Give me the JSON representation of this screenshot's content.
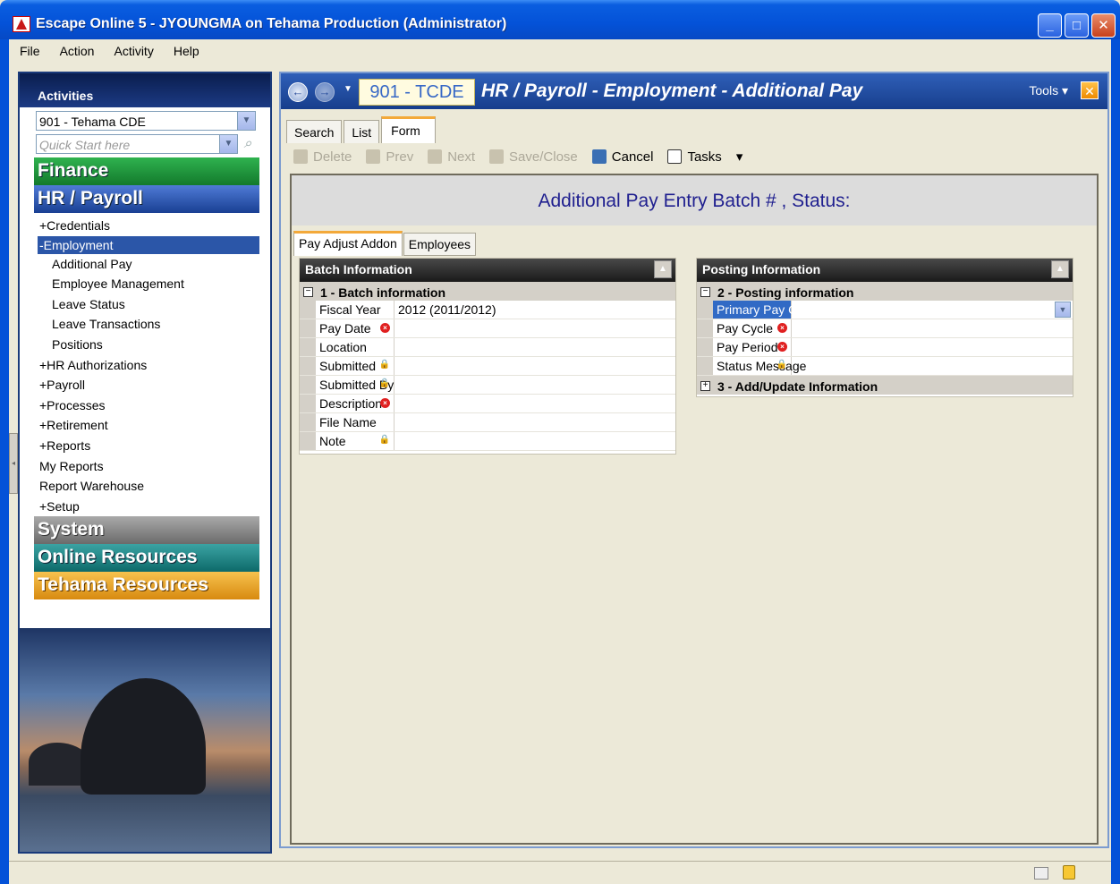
{
  "window": {
    "title": "Escape Online 5 - JYOUNGMA on Tehama Production (Administrator)",
    "minimize": "_",
    "maximize": "□",
    "close": "✕"
  },
  "menu": [
    "File",
    "Action",
    "Activity",
    "Help"
  ],
  "sidebar": {
    "header": "Activities",
    "district_combo": "901 - Tehama CDE",
    "quick_start_placeholder": "Quick Start here",
    "sections": {
      "finance": "Finance",
      "hr": "HR / Payroll",
      "system": "System",
      "online": "Online Resources",
      "tehama": "Tehama Resources"
    },
    "tree": [
      {
        "label": "+Credentials",
        "level": 0
      },
      {
        "label": "-Employment",
        "level": 0,
        "selected": true
      },
      {
        "label": "Additional Pay",
        "level": 1
      },
      {
        "label": "Employee Management",
        "level": 1
      },
      {
        "label": "Leave Status",
        "level": 1
      },
      {
        "label": "Leave Transactions",
        "level": 1
      },
      {
        "label": "Positions",
        "level": 1
      },
      {
        "label": "+HR Authorizations",
        "level": 0
      },
      {
        "label": "+Payroll",
        "level": 0
      },
      {
        "label": "+Processes",
        "level": 0
      },
      {
        "label": "+Retirement",
        "level": 0
      },
      {
        "label": "+Reports",
        "level": 0
      },
      {
        "label": "My Reports",
        "level": 0
      },
      {
        "label": "Report Warehouse",
        "level": 0
      },
      {
        "label": "+Setup",
        "level": 0
      }
    ]
  },
  "header": {
    "org": "901 - TCDE",
    "page_title": "HR / Payroll - Employment - Additional Pay",
    "tools": "Tools ▾",
    "close": "✕"
  },
  "view_tabs": [
    "Search",
    "List",
    "Form"
  ],
  "toolbar": {
    "delete": "Delete",
    "prev": "Prev",
    "next": "Next",
    "save_close": "Save/Close",
    "cancel": "Cancel",
    "tasks": "Tasks",
    "more": "▾"
  },
  "banner": "Additional Pay Entry Batch # , Status:",
  "sub_tabs": [
    "Pay Adjust Addon",
    "Employees"
  ],
  "batch_group": {
    "header": "Batch Information",
    "category": "1 - Batch information",
    "rows": [
      {
        "label": "Fiscal Year",
        "value": "2012 (2011/2012)",
        "marker": ""
      },
      {
        "label": "Pay Date",
        "value": "",
        "marker": "required"
      },
      {
        "label": "Location",
        "value": "",
        "marker": ""
      },
      {
        "label": "Submitted",
        "value": "",
        "marker": "locked"
      },
      {
        "label": "Submitted By",
        "value": "",
        "marker": "locked"
      },
      {
        "label": "Description",
        "value": "",
        "marker": "required"
      },
      {
        "label": "File Name",
        "value": "",
        "marker": ""
      },
      {
        "label": "Note",
        "value": "",
        "marker": "locked"
      }
    ]
  },
  "posting_group": {
    "header": "Posting Information",
    "category": "2 - Posting information",
    "rows": [
      {
        "label": "Primary Pay Cycle?",
        "value": "",
        "marker": "",
        "selected": true,
        "dropdown": true
      },
      {
        "label": "Pay Cycle",
        "value": "",
        "marker": "required"
      },
      {
        "label": "Pay Period",
        "value": "",
        "marker": "required"
      },
      {
        "label": "Status Message",
        "value": "",
        "marker": "locked"
      }
    ],
    "category2": "3 - Add/Update Information"
  }
}
